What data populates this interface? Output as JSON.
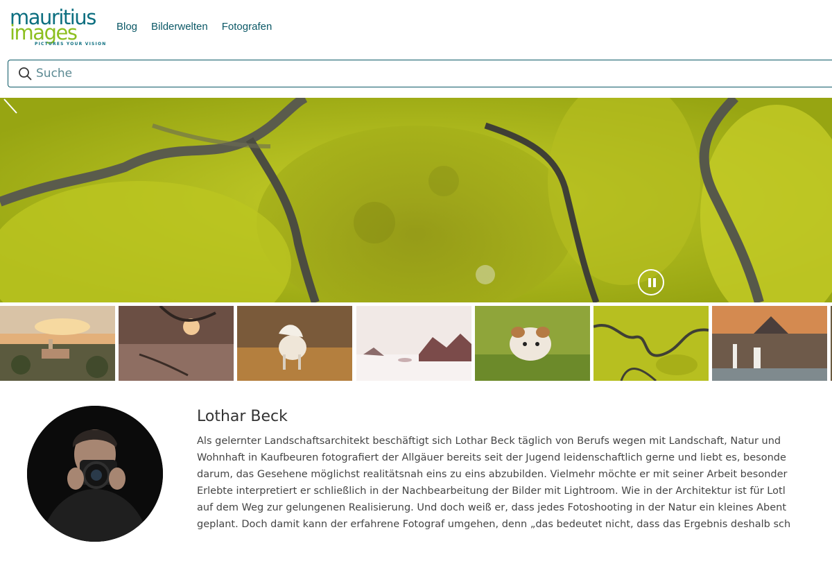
{
  "logo": {
    "line1": "mauritius",
    "line2": "images",
    "tagline": "PICTURES YOUR VISION",
    "color_primary": "#0d6f80",
    "color_accent": "#8cbf1f"
  },
  "nav": {
    "items": [
      {
        "label": "Blog"
      },
      {
        "label": "Bilderwelten"
      },
      {
        "label": "Fotografen"
      }
    ]
  },
  "search": {
    "placeholder": "Suche",
    "icon": "search-icon"
  },
  "hero": {
    "icons": {
      "prev": "chevron-left-icon",
      "pause": "pause-icon"
    }
  },
  "thumbnails": [
    {
      "subject": "town-sunset"
    },
    {
      "subject": "tree-lake"
    },
    {
      "subject": "horse-field"
    },
    {
      "subject": "snowy-trees"
    },
    {
      "subject": "puppy-grass"
    },
    {
      "subject": "aerial-river"
    },
    {
      "subject": "kirkjufell-waterfall"
    }
  ],
  "photographer": {
    "name": "Lothar Beck",
    "bio_lines": [
      "Als gelernter Landschaftsarchitekt beschäftigt sich Lothar Beck täglich von Berufs wegen mit Landschaft, Natur und",
      "Wohnhaft in Kaufbeuren fotografiert der Allgäuer bereits seit der Jugend leidenschaftlich gerne und liebt es, besonde",
      "darum, das Gesehene möglichst realitätsnah eins zu eins abzubilden. Vielmehr möchte er mit seiner Arbeit besonder",
      "Erlebte interpretiert er schließlich in der Nachbearbeitung der Bilder mit Lightroom. Wie in der Architektur ist für Lotl",
      "auf dem Weg zur gelungenen Realisierung. Und doch weiß er, dass jedes Fotoshooting in der Natur ein kleines Abent",
      "geplant. Doch damit kann der erfahrene Fotograf umgehen, denn „das bedeutet nicht, dass das Ergebnis deshalb sch"
    ]
  }
}
